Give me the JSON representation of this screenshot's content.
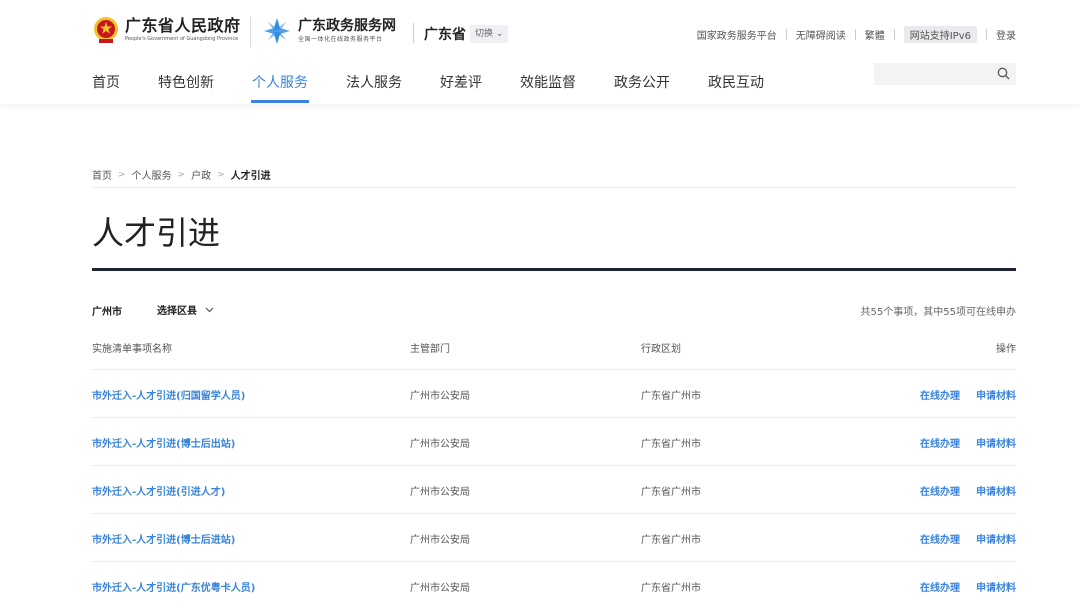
{
  "header": {
    "gov_name": "广东省人民政府",
    "gov_en": "People's Government of Guangdong Province",
    "service_name": "广东政务服务网",
    "service_sub": "全国一体化在线政务服务平台",
    "region": "广东省",
    "switch_label": "切换",
    "top_links": [
      "国家政务服务平台",
      "无障碍阅读",
      "繁體",
      "网站支持IPv6",
      "登录"
    ],
    "search_placeholder": ""
  },
  "nav": {
    "items": [
      "首页",
      "特色创新",
      "个人服务",
      "法人服务",
      "好差评",
      "效能监督",
      "政务公开",
      "政民互动"
    ],
    "active_index": 2
  },
  "breadcrumb": [
    "首页",
    "个人服务",
    "户政",
    "人才引进"
  ],
  "page_title": "人才引进",
  "filter": {
    "city": "广州市",
    "district_label": "选择区县",
    "summary": "共55个事项，其中55项可在线申办"
  },
  "table": {
    "headers": [
      "实施清单事项名称",
      "主管部门",
      "行政区划",
      "操作"
    ],
    "rows": [
      {
        "name": "市外迁入-人才引进(归国留学人员)",
        "dept": "广州市公安局",
        "area": "广东省广州市",
        "ops": [
          "在线办理",
          "申请材料"
        ]
      },
      {
        "name": "市外迁入-人才引进(博士后出站)",
        "dept": "广州市公安局",
        "area": "广东省广州市",
        "ops": [
          "在线办理",
          "申请材料"
        ]
      },
      {
        "name": "市外迁入-人才引进(引进人才)",
        "dept": "广州市公安局",
        "area": "广东省广州市",
        "ops": [
          "在线办理",
          "申请材料"
        ]
      },
      {
        "name": "市外迁入-人才引进(博士后进站)",
        "dept": "广州市公安局",
        "area": "广东省广州市",
        "ops": [
          "在线办理",
          "申请材料"
        ]
      },
      {
        "name": "市外迁入-人才引进(广东优粤卡人员)",
        "dept": "广州市公安局",
        "area": "广东省广州市",
        "ops": [
          "在线办理",
          "申请材料"
        ]
      }
    ]
  },
  "colors": {
    "accent": "#3a84d9",
    "title_rule": "#1e2433",
    "emblem_red": "#c8161d",
    "emblem_gold": "#f2c12e",
    "service_blue": "#2f8fe0"
  }
}
